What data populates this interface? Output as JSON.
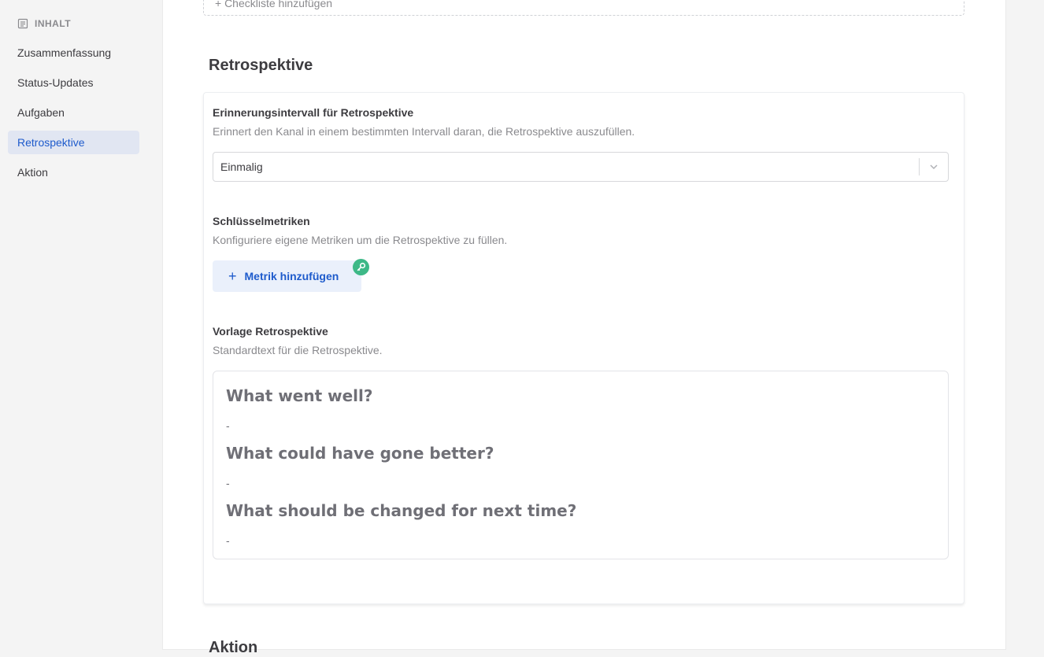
{
  "sidebar": {
    "header": "INHALT",
    "items": [
      {
        "label": "Zusammenfassung"
      },
      {
        "label": "Status-Updates"
      },
      {
        "label": "Aufgaben"
      },
      {
        "label": "Retrospektive"
      },
      {
        "label": "Aktion"
      }
    ],
    "active_item": "Retrospektive"
  },
  "checklist": {
    "add_label": "+ Checkliste hinzufügen"
  },
  "retrospective": {
    "title": "Retrospektive",
    "reminder": {
      "label": "Erinnerungsintervall für Retrospektive",
      "description": "Erinnert den Kanal in einem bestimmten Intervall daran, die Retrospektive auszufüllen.",
      "selected_value": "Einmalig"
    },
    "metrics": {
      "label": "Schlüsselmetriken",
      "description": "Konfiguriere eigene Metriken um die Retrospektive zu füllen.",
      "add_button": "Metrik hinzufügen",
      "badge_icon": "key-icon"
    },
    "template": {
      "label": "Vorlage Retrospektive",
      "description": "Standardtext für die Retrospektive.",
      "heading_1": "What went well?",
      "dash_1": "-",
      "heading_2": "What could have gone better?",
      "dash_2": "-",
      "heading_3": "What should be changed for next time?",
      "dash_3": "-"
    }
  },
  "next_section": {
    "title": "Aktion"
  },
  "colors": {
    "accent": "#1e5bcc",
    "active_bg": "#e1e6f2",
    "badge_green": "#3db887"
  }
}
